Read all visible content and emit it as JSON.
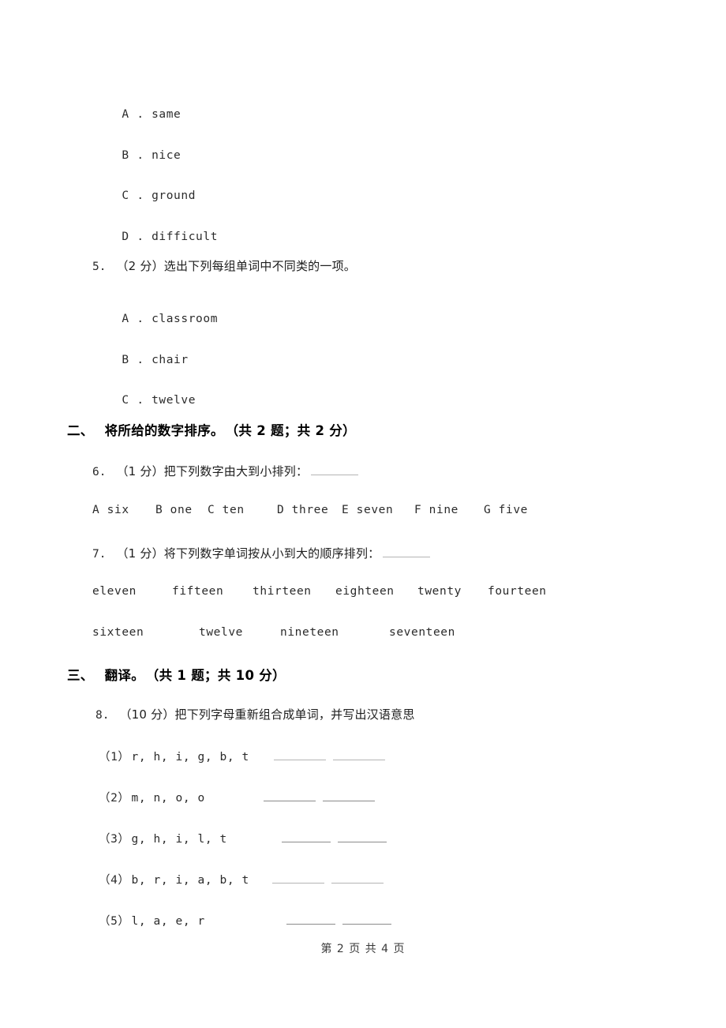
{
  "document": {
    "footer": "第 2 页 共 4 页"
  },
  "question4_options": [
    {
      "letter": "A",
      "text": "same"
    },
    {
      "letter": "B",
      "text": "nice"
    },
    {
      "letter": "C",
      "text": "ground"
    },
    {
      "letter": "D",
      "text": "difficult"
    }
  ],
  "question5": {
    "number": "5.",
    "stem": "（2 分）选出下列每组单词中不同类的一项。",
    "options": [
      {
        "letter": "A",
        "text": "classroom"
      },
      {
        "letter": "B",
        "text": "chair"
      },
      {
        "letter": "C",
        "text": "twelve"
      }
    ]
  },
  "section2": {
    "index": "二、",
    "title": "将所给的数字排序。",
    "meta": "（共 2 题；共 2 分）"
  },
  "question6": {
    "number": "6.",
    "stem": "（1 分）把下列数字由大到小排列：",
    "choices": [
      "A six",
      "B one",
      "C ten",
      "D three",
      "E seven",
      "F nine",
      "G five"
    ]
  },
  "question7": {
    "number": "7.",
    "stem": "（1 分）将下列数字单词按从小到大的顺序排列：",
    "words_row1": [
      "eleven",
      "fifteen",
      "thirteen",
      "eighteen",
      "twenty",
      "fourteen"
    ],
    "words_row2": [
      "sixteen",
      "twelve",
      "nineteen",
      "seventeen"
    ]
  },
  "section3": {
    "index": "三、",
    "title": "翻译。",
    "meta": "（共 1 题；共 10 分）"
  },
  "question8": {
    "number": "8.",
    "stem": "（10 分）把下列字母重新组合成单词，并写出汉语意思",
    "items": [
      {
        "label": "（1）",
        "letters": "r, h, i, g, b, t"
      },
      {
        "label": "（2）",
        "letters": "m, n, o, o"
      },
      {
        "label": "（3）",
        "letters": "g, h, i, l, t"
      },
      {
        "label": "（4）",
        "letters": "b, r, i, a, b, t"
      },
      {
        "label": "（5）",
        "letters": "l, a, e, r"
      }
    ]
  }
}
